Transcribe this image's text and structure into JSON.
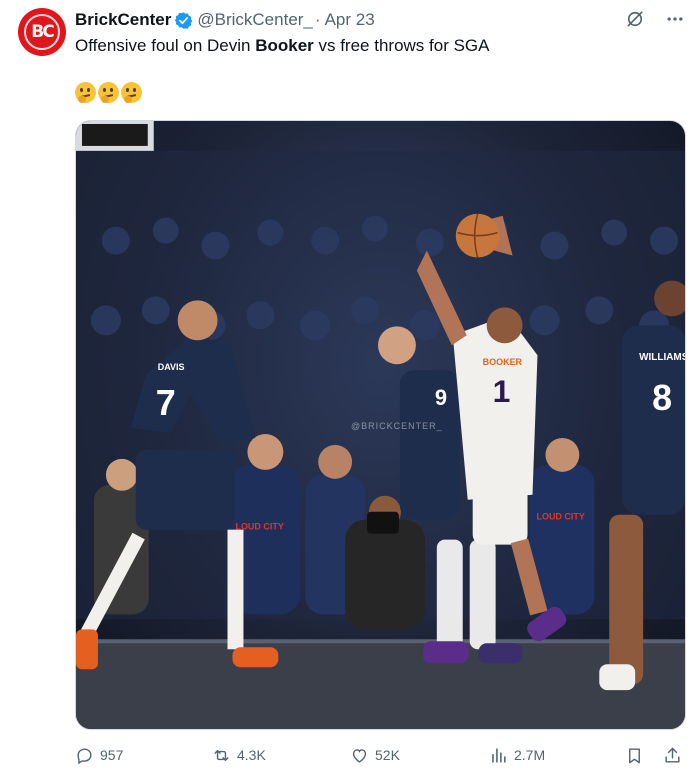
{
  "tweet": {
    "avatar_text": "BC",
    "display_name": "BrickCenter",
    "handle": "@BrickCenter_",
    "separator": "·",
    "date": "Apr 23",
    "text_before": "Offensive foul on Devin ",
    "text_bold": "Booker",
    "text_after": " vs free throws for SGA",
    "emojis": [
      "thinking-face",
      "thinking-face",
      "thinking-face"
    ]
  },
  "media": {
    "watermark": "@BRICKCENTER_",
    "jerseys": {
      "left_player_name": "DAVIS",
      "left_player_number": "7",
      "booker_name": "BOOKER",
      "booker_number": "1",
      "right_player_name": "WILLIAMS",
      "right_player_number": "8",
      "caruso_number": "9"
    },
    "crowd_shirt_text": "LOUD CITY"
  },
  "actions": {
    "replies": "957",
    "reposts": "4.3K",
    "likes": "52K",
    "views": "2.7M"
  },
  "colors": {
    "brand_red": "#e0161c",
    "verified_blue": "#1d9bf0",
    "secondary_text": "#536471",
    "thunder_navy": "#1f2d4d",
    "suns_white": "#f2f0ec",
    "suns_orange": "#e56020"
  },
  "icons": [
    "verified-badge-icon",
    "grok-icon",
    "more-icon",
    "reply-icon",
    "repost-icon",
    "like-icon",
    "views-icon",
    "bookmark-icon",
    "share-icon"
  ]
}
